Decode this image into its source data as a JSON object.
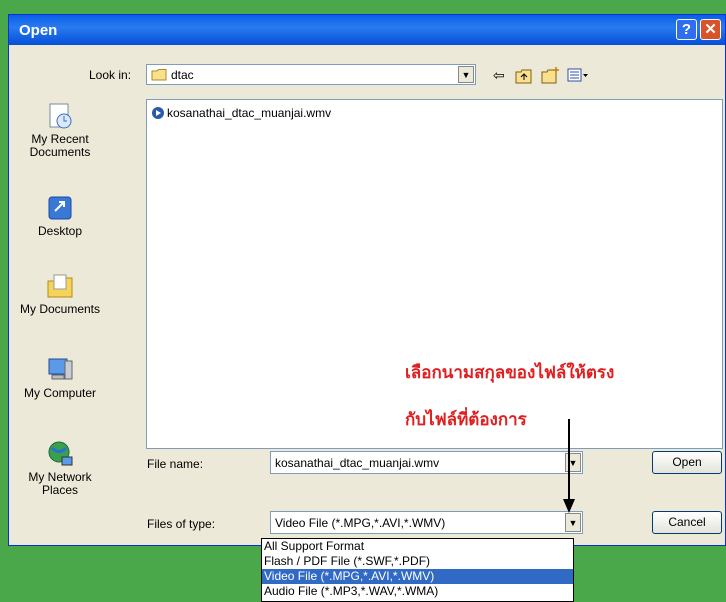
{
  "window": {
    "title": "Open",
    "help_label": "?",
    "close_label": "✕"
  },
  "look_in": {
    "label": "Look in:",
    "value": "dtac"
  },
  "places": [
    {
      "label": "My Recent Documents"
    },
    {
      "label": "Desktop"
    },
    {
      "label": "My Documents"
    },
    {
      "label": "My Computer"
    },
    {
      "label": "My Network Places"
    }
  ],
  "files": [
    {
      "name": "kosanathai_dtac_muanjai.wmv"
    }
  ],
  "file_name": {
    "label": "File name:",
    "value": "kosanathai_dtac_muanjai.wmv"
  },
  "file_type": {
    "label": "Files of type:",
    "value": "Video File (*.MPG,*.AVI,*.WMV)"
  },
  "buttons": {
    "open": "Open",
    "cancel": "Cancel"
  },
  "type_options": [
    "All Support Format",
    "Flash / PDF File (*.SWF,*.PDF)",
    "Video File (*.MPG,*.AVI,*.WMV)",
    "Audio File (*.MP3,*.WAV,*.WMA)"
  ],
  "selected_option_index": 2,
  "annotation": {
    "line1": "เลือกนามสกุลของไฟล์ให้ตรง",
    "line2": "กับไฟล์ที่ต้องการ",
    "color": "#e02020"
  },
  "colors": {
    "titlebar": "#0a5fe8",
    "selection": "#316ac5",
    "background": "#4aa84a"
  },
  "icons": [
    "folder-icon",
    "back-arrow-icon",
    "up-folder-icon",
    "new-folder-icon",
    "views-menu-icon",
    "video-file-icon"
  ]
}
